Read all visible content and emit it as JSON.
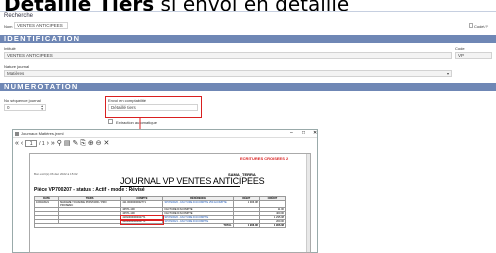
{
  "headline": {
    "bold": "Détaille Tiers",
    "rest": " si envoi en détaille"
  },
  "search": {
    "title": "Recherche",
    "label": "Nom",
    "value": "VENTES ANTICIPEES",
    "code_label": "Code",
    "code_value": "VP"
  },
  "identification": {
    "bar": "IDENTIFICATION",
    "intitule_label": "Intitulé",
    "intitule_value": "VENTES ANTICIPEES",
    "code_label": "Code",
    "code_value": "VP",
    "nature_label": "Nature journal",
    "nature_value": "Matières"
  },
  "numerotation": {
    "bar": "NUMEROTATION",
    "sequence_label": "No séquence journal",
    "sequence_value": "0",
    "envoi_label": "Envoi en comptabilité",
    "envoi_value": "Détaillé tiers",
    "extraction_label": "Extraction automatique"
  },
  "report_window": {
    "title": "Journaux Matières.jrxml",
    "page_value": "1",
    "page_total": "/ 1",
    "stamp": "ECRITURES CROISEES 2",
    "company": "SAMA_TERRA",
    "small_header": "Bon écrit(s) 06 déc 2022 à 15:02",
    "journal_title": "JOURNAL VP VENTES ANTICIPEES",
    "piece_line": "Pièce VP700207 - status : Actif - mode : Révisé",
    "columns": [
      "DATE",
      "TIERS",
      "COMPTE",
      "RÉFÉRENCE",
      "DÉBIT",
      "CRÉDIT"
    ],
    "rows": [
      {
        "date": "10/03/2021",
        "tiers": "MADAME YOUANNE POINTARD / PRO PROSEMC",
        "compte": "411 0000000002771",
        "reference": "SPVIS0020 - FACTURE D'ACOMPTE 250 ACOMPTE",
        "debit": "1 906.08",
        "credit": ""
      },
      {
        "date": "",
        "tiers": "",
        "compte": "44571-100",
        "reference": "FACTURE D'ACOMPTE",
        "debit": "",
        "credit": "11.00"
      },
      {
        "date": "",
        "tiers": "",
        "compte": "44571-100",
        "reference": "FACTURE D'ACOMPTE",
        "debit": "",
        "credit": "400.00"
      },
      {
        "date": "",
        "tiers": "",
        "compte": "4181000000002771",
        "reference": "SPVIS0020 - FACTURE D'ACOMPTE",
        "debit": "",
        "credit": "1 295.08"
      },
      {
        "date": "",
        "tiers": "",
        "compte": "4181000000002771",
        "reference": "SPVIS0021 - FACTURE D'ACOMPTE",
        "debit": "",
        "credit": "200.00"
      }
    ],
    "total_label": "TOTAL",
    "total_debit": "1 906.08",
    "total_credit": "1 906.08"
  }
}
